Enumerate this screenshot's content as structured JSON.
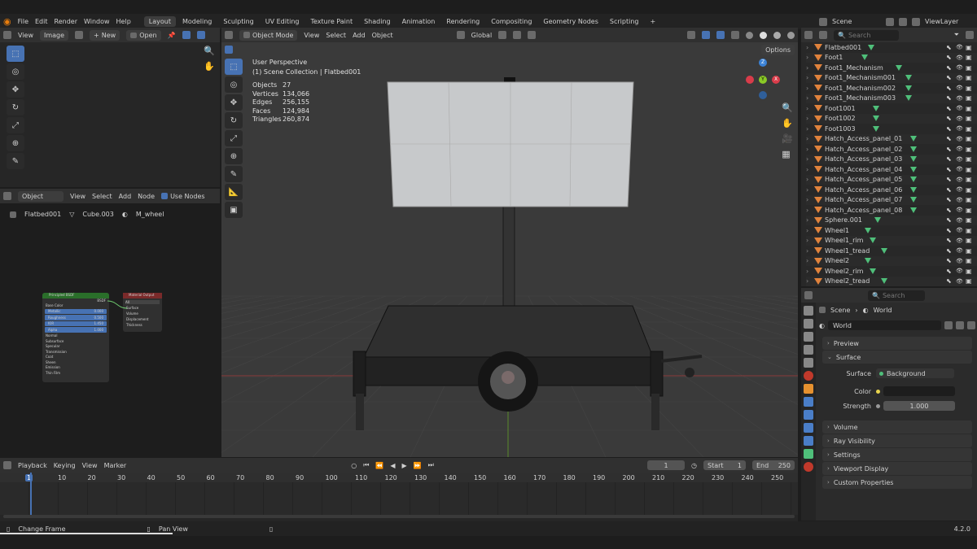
{
  "topbar": {
    "menus": [
      "File",
      "Edit",
      "Render",
      "Window",
      "Help"
    ],
    "tabs": [
      "Layout",
      "Modeling",
      "Sculpting",
      "UV Editing",
      "Texture Paint",
      "Shading",
      "Animation",
      "Rendering",
      "Compositing",
      "Geometry Nodes",
      "Scripting"
    ],
    "add": "+",
    "scene": "Scene",
    "viewlayer": "ViewLayer"
  },
  "image_editor": {
    "menus": [
      "View",
      "Image"
    ],
    "new": "New",
    "open": "Open"
  },
  "node_editor": {
    "mode": "Object",
    "menus": [
      "View",
      "Select",
      "Add",
      "Node"
    ],
    "use_nodes": "Use Nodes",
    "breadcrumb": [
      "Flatbed001",
      "Cube.003",
      "M_wheel"
    ],
    "principled": {
      "title": "Principled BSDF",
      "bsdf": "BSDF",
      "rows": [
        "Base Color",
        "Metallic",
        "Roughness",
        "IOR",
        "Alpha",
        "Normal",
        "Subsurface",
        "Specular",
        "Transmission",
        "Coat",
        "Sheen",
        "Emission",
        "Thin Film"
      ],
      "values": [
        "",
        "0.000",
        "0.500",
        "1.450",
        "1.000"
      ]
    },
    "output": {
      "title": "Material Output",
      "target": "All",
      "rows": [
        "Surface",
        "Volume",
        "Displacement",
        "Thickness"
      ]
    }
  },
  "viewport": {
    "mode": "Object Mode",
    "menus": [
      "View",
      "Select",
      "Add",
      "Object"
    ],
    "transform": "Global",
    "options": "Options",
    "title": "User Perspective",
    "collection": "(1) Scene Collection | Flatbed001",
    "stats": [
      [
        "Objects",
        "27"
      ],
      [
        "Vertices",
        "134,066"
      ],
      [
        "Edges",
        "256,155"
      ],
      [
        "Faces",
        "124,984"
      ],
      [
        "Triangles",
        "260,874"
      ]
    ],
    "gizmo": {
      "x": "X",
      "y": "Y",
      "z": "Z"
    }
  },
  "outliner": {
    "search": "Search",
    "items": [
      "Flatbed001",
      "Foot1",
      "Foot1_Mechanism",
      "Foot1_Mechanism001",
      "Foot1_Mechanism002",
      "Foot1_Mechanism003",
      "Foot1001",
      "Foot1002",
      "Foot1003",
      "Hatch_Access_panel_01",
      "Hatch_Access_panel_02",
      "Hatch_Access_panel_03",
      "Hatch_Access_panel_04",
      "Hatch_Access_panel_05",
      "Hatch_Access_panel_06",
      "Hatch_Access_panel_07",
      "Hatch_Access_panel_08",
      "Sphere.001",
      "Wheel1",
      "Wheel1_rim",
      "Wheel1_tread",
      "Wheel2",
      "Wheel2_rim",
      "Wheel2_tread"
    ]
  },
  "properties": {
    "search": "Search",
    "crumb_scene": "Scene",
    "crumb_world": "World",
    "world": "World",
    "preview": "Preview",
    "surface": "Surface",
    "surface_label": "Surface",
    "surface_value": "Background",
    "color_label": "Color",
    "strength_label": "Strength",
    "strength_value": "1.000",
    "sections": [
      "Volume",
      "Ray Visibility",
      "Settings",
      "Viewport Display",
      "Custom Properties"
    ]
  },
  "timeline": {
    "menus": [
      "Playback",
      "Keying",
      "View",
      "Marker"
    ],
    "current": "1",
    "start_label": "Start",
    "start": "1",
    "end_label": "End",
    "end": "250",
    "ticks": [
      "1",
      "10",
      "20",
      "30",
      "40",
      "50",
      "60",
      "70",
      "80",
      "90",
      "100",
      "110",
      "120",
      "130",
      "140",
      "150",
      "160",
      "170",
      "180",
      "190",
      "200",
      "210",
      "220",
      "230",
      "240",
      "250"
    ]
  },
  "statusbar": {
    "left": "Change Frame",
    "mid": "Pan View",
    "version": "4.2.0"
  }
}
